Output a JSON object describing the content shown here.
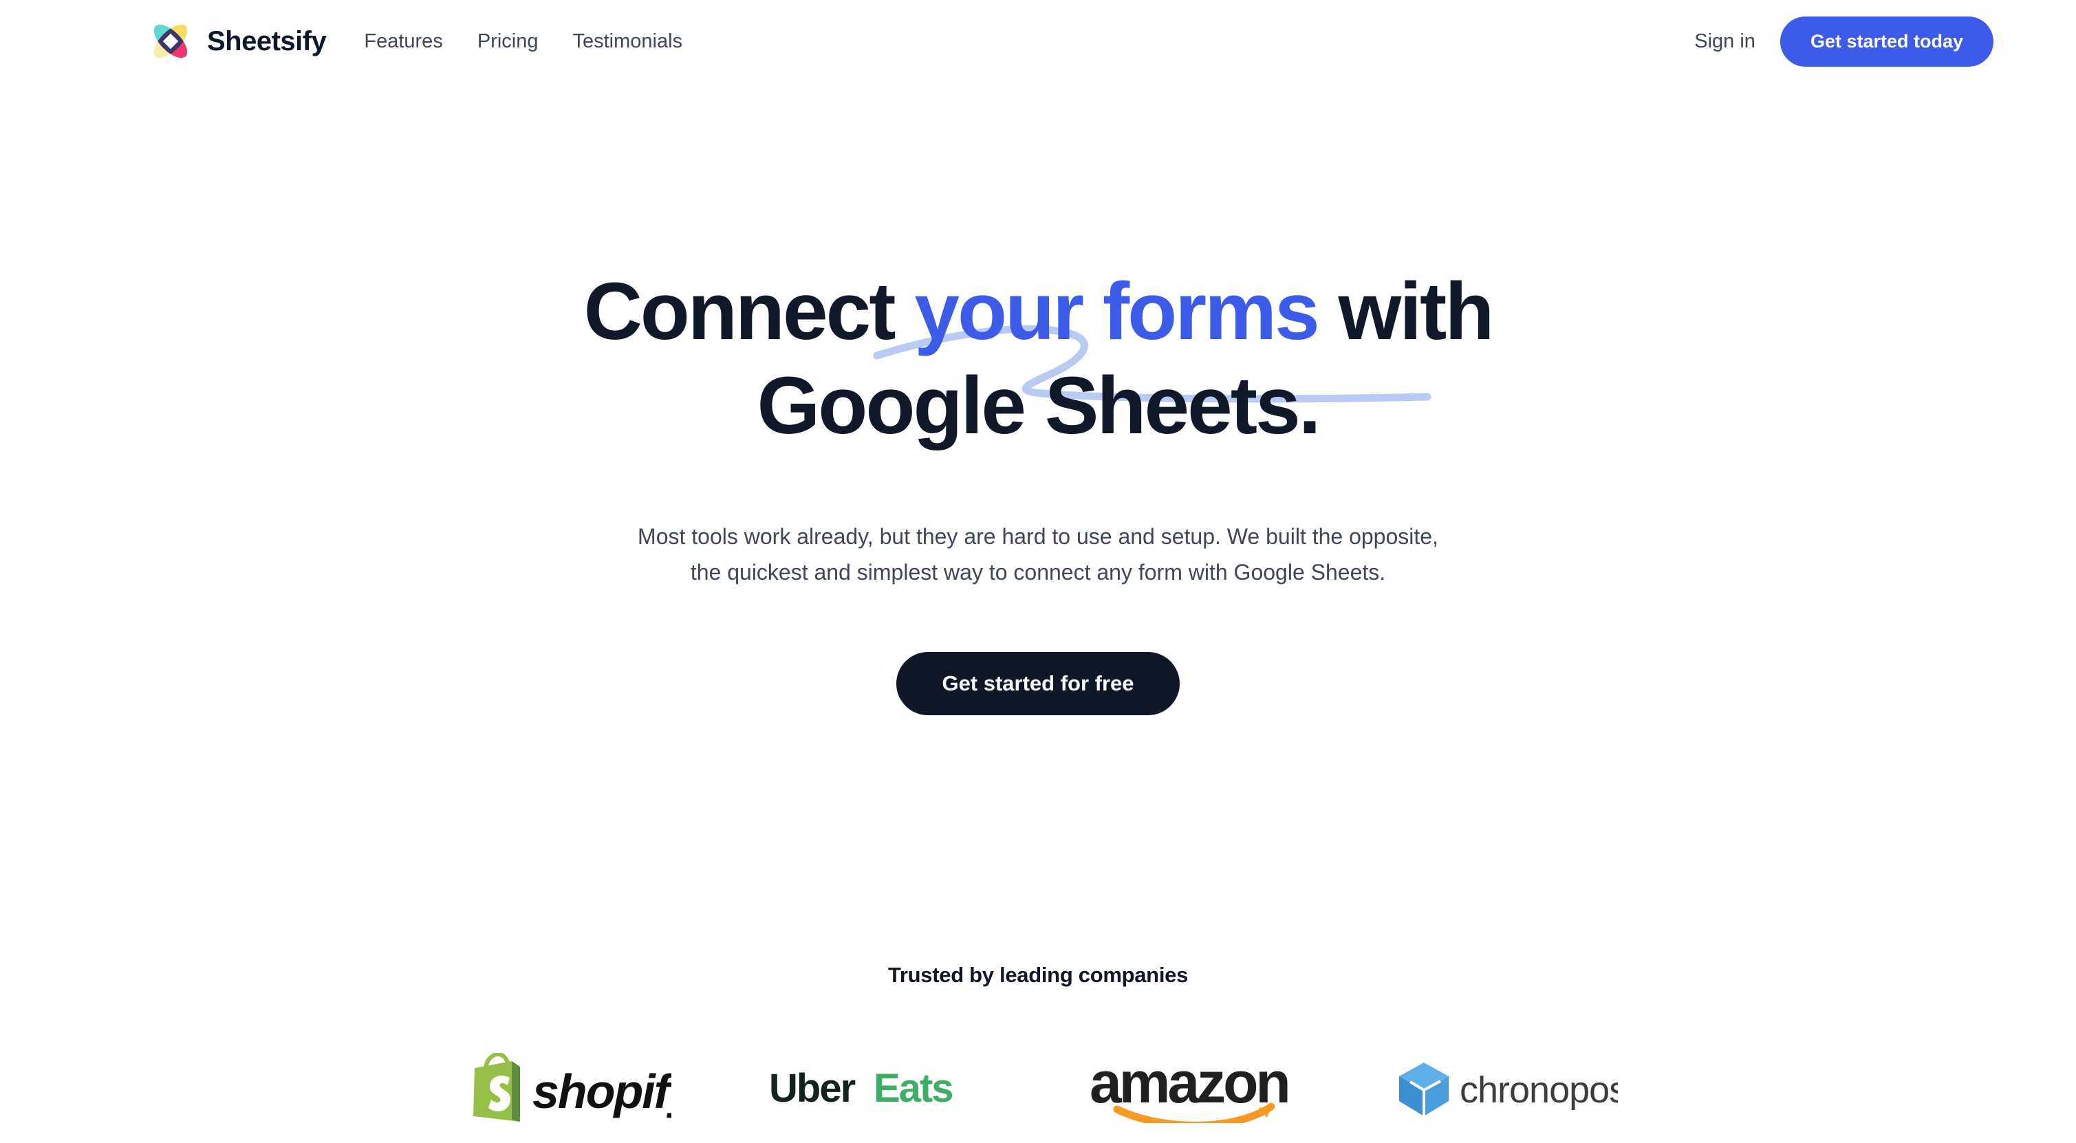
{
  "header": {
    "brand_name": "Sheetsify",
    "logo_icon": "sheetsify-petal-logo",
    "nav": [
      {
        "label": "Features"
      },
      {
        "label": "Pricing"
      },
      {
        "label": "Testimonials"
      }
    ],
    "signin_label": "Sign in",
    "cta_label": "Get started today"
  },
  "hero": {
    "headline_part1": "Connect ",
    "headline_accent": "your forms",
    "headline_part2": " with",
    "headline_line2": "Google Sheets.",
    "subhead_line1": "Most tools work already, but they are hard to use and setup. We built the opposite,",
    "subhead_line2": "the quickest and simplest way to connect any form with Google Sheets.",
    "cta_label": "Get started for free",
    "underline_icon": "hand-drawn-swoosh-underline"
  },
  "trusted": {
    "title": "Trusted by leading companies",
    "logos": [
      {
        "name": "Shopify",
        "icon": "shopify-logo"
      },
      {
        "name": "Uber Eats",
        "icon": "ubereats-logo"
      },
      {
        "name": "amazon",
        "icon": "amazon-logo"
      },
      {
        "name": "chronopost",
        "icon": "chronopost-logo"
      }
    ]
  },
  "colors": {
    "accent_blue": "#3b5be8",
    "swoosh_blue": "#b9cbf2",
    "dark": "#101828",
    "body_text": "#3f4654",
    "shopify_green": "#95bf47",
    "ubereats_green": "#3fae65",
    "amazon_orange": "#f59a23",
    "chronopost_blue": "#4a9ede"
  }
}
